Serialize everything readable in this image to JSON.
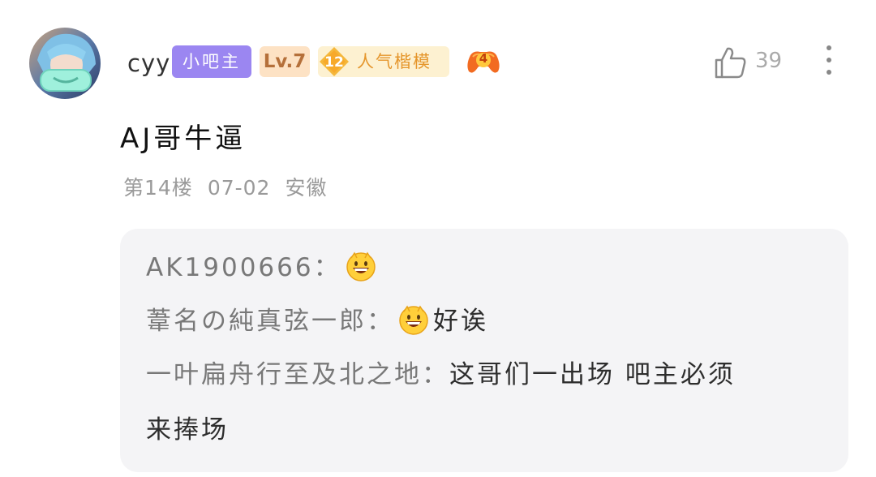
{
  "comment": {
    "username": "cyy",
    "badges": {
      "bazhu": "小吧主",
      "level": "Lv.7",
      "popularity_number": "12",
      "popularity_title": "人气楷模",
      "game_badge_number": "4"
    },
    "like_count": "39",
    "content": "AJ哥牛逼",
    "meta": {
      "floor": "第14楼",
      "date": "07-02",
      "location": "安徽"
    }
  },
  "replies": [
    {
      "author": "AK1900666：",
      "emoji": "grinning-face-emoji",
      "text": ""
    },
    {
      "author": "葦名の純真弦一郎：",
      "emoji": "grinning-face-emoji",
      "text": "好诶"
    },
    {
      "author": "一叶扁舟行至及北之地：",
      "emoji": "",
      "text": "这哥们一出场 吧主必须",
      "text_continued": "来捧场"
    }
  ],
  "colors": {
    "bazhu_badge": "#9b86f1",
    "level_badge_bg": "#fde2c4",
    "popularity_badge_bg": "#fdf1d1",
    "reply_box_bg": "#f4f4f6"
  }
}
